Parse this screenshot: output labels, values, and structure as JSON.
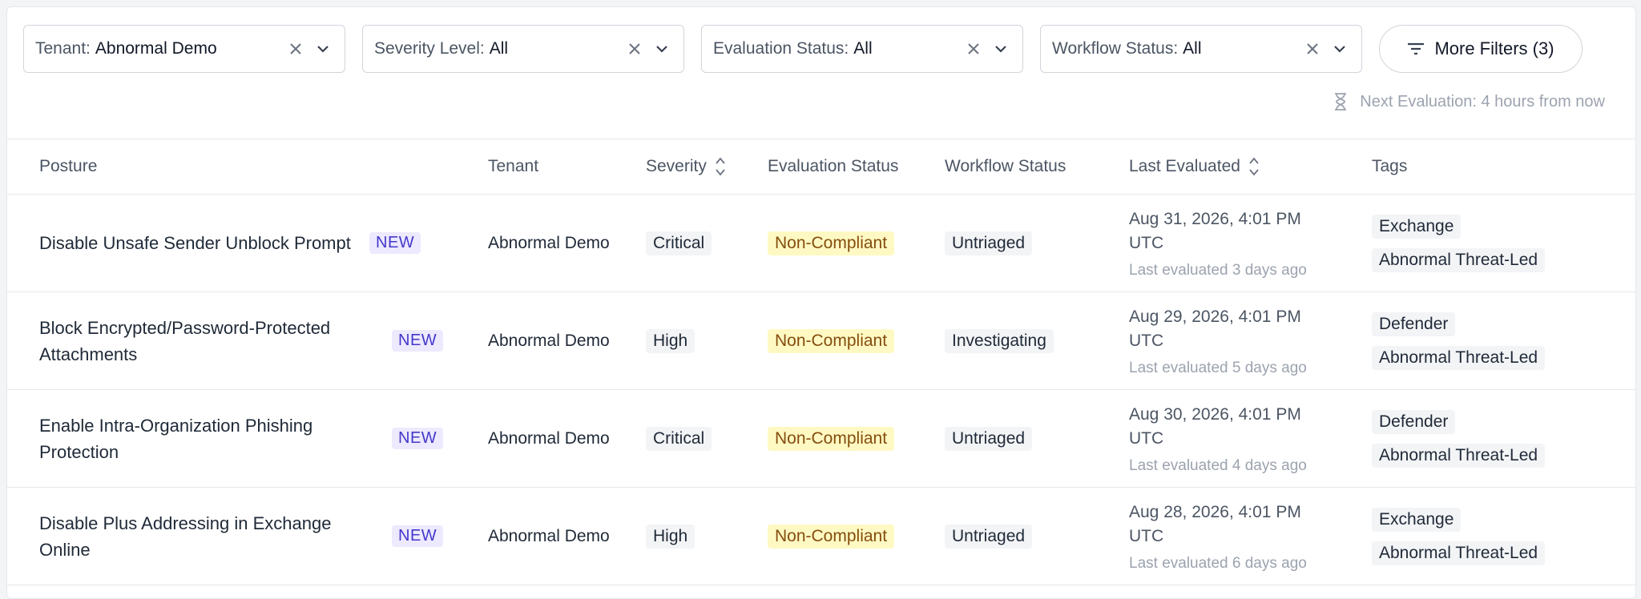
{
  "filters": [
    {
      "label": "Tenant:",
      "value": "Abnormal Demo"
    },
    {
      "label": "Severity Level:",
      "value": "All"
    },
    {
      "label": "Evaluation Status:",
      "value": "All"
    },
    {
      "label": "Workflow Status:",
      "value": "All"
    }
  ],
  "more_filters_label": "More Filters (3)",
  "next_evaluation": "Next Evaluation: 4 hours from now",
  "columns": {
    "posture": "Posture",
    "tenant": "Tenant",
    "severity": "Severity",
    "evaluation_status": "Evaluation Status",
    "workflow_status": "Workflow Status",
    "last_evaluated": "Last Evaluated",
    "tags": "Tags"
  },
  "rows": [
    {
      "posture": "Disable Unsafe Sender Unblock Prompt",
      "badge": "NEW",
      "tenant": "Abnormal Demo",
      "severity": "Critical",
      "evaluation_status": "Non-Compliant",
      "workflow_status": "Untriaged",
      "last_evaluated": "Aug 31, 2026, 4:01 PM UTC",
      "last_evaluated_rel": "Last evaluated 3 days ago",
      "tags": [
        "Exchange",
        "Abnormal Threat-Led"
      ]
    },
    {
      "posture": "Block Encrypted/Password-Protected Attachments",
      "badge": "NEW",
      "tenant": "Abnormal Demo",
      "severity": "High",
      "evaluation_status": "Non-Compliant",
      "workflow_status": "Investigating",
      "last_evaluated": "Aug 29, 2026, 4:01 PM UTC",
      "last_evaluated_rel": "Last evaluated 5 days ago",
      "tags": [
        "Defender",
        "Abnormal Threat-Led"
      ]
    },
    {
      "posture": "Enable Intra-Organization Phishing Protection",
      "badge": "NEW",
      "tenant": "Abnormal Demo",
      "severity": "Critical",
      "evaluation_status": "Non-Compliant",
      "workflow_status": "Untriaged",
      "last_evaluated": "Aug 30, 2026, 4:01 PM UTC",
      "last_evaluated_rel": "Last evaluated 4 days ago",
      "tags": [
        "Defender",
        "Abnormal Threat-Led"
      ]
    },
    {
      "posture": "Disable Plus Addressing in Exchange Online",
      "badge": "NEW",
      "tenant": "Abnormal Demo",
      "severity": "High",
      "evaluation_status": "Non-Compliant",
      "workflow_status": "Untriaged",
      "last_evaluated": "Aug 28, 2026, 4:01 PM UTC",
      "last_evaluated_rel": "Last evaluated 6 days ago",
      "tags": [
        "Exchange",
        "Abnormal Threat-Led"
      ]
    }
  ],
  "icons": {
    "clear": "close-icon",
    "dropdown": "chevron-down-icon",
    "filter": "filter-lines-icon",
    "hourglass": "hourglass-icon",
    "sort": "sort-icon"
  },
  "colors": {
    "new_badge_bg": "#ede9fe",
    "new_badge_text": "#4338ca",
    "non_compliant_bg": "#fef9c3",
    "non_compliant_text": "#854d0e",
    "chip_bg": "#f3f4f6"
  }
}
